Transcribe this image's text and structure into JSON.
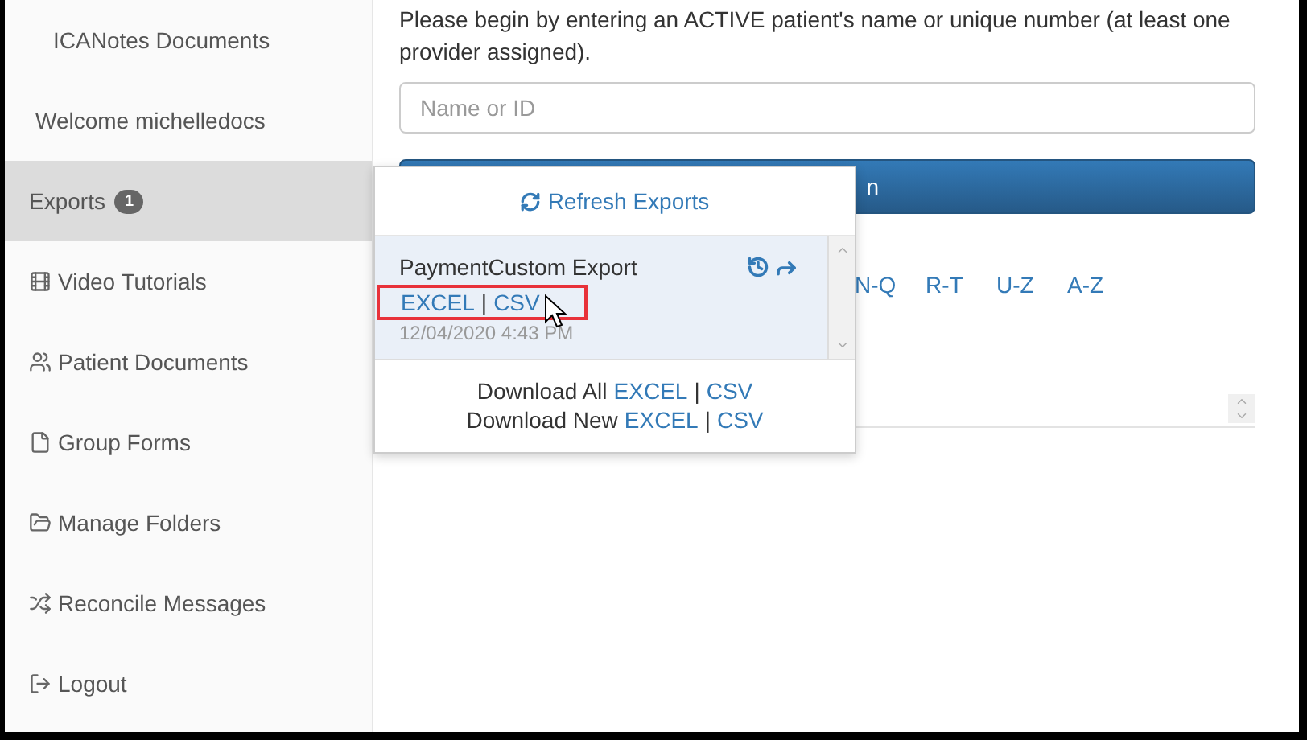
{
  "sidebar": {
    "items": [
      {
        "label": "ICANotes Documents",
        "kind": "title",
        "selected": false
      },
      {
        "label": "Welcome michelledocs",
        "kind": "title",
        "selected": false
      },
      {
        "label": "Exports",
        "kind": "link",
        "selected": true,
        "badge": "1"
      },
      {
        "label": "Video Tutorials",
        "kind": "link",
        "selected": false
      },
      {
        "label": "Patient Documents",
        "kind": "link",
        "selected": false
      },
      {
        "label": "Group Forms",
        "kind": "link",
        "selected": false
      },
      {
        "label": "Manage Folders",
        "kind": "link",
        "selected": false
      },
      {
        "label": "Reconcile Messages",
        "kind": "link",
        "selected": false
      },
      {
        "label": "Logout",
        "kind": "link",
        "selected": false
      }
    ]
  },
  "main": {
    "instructions": "Please begin by entering an ACTIVE patient's name or unique number (at least one provider assigned).",
    "search": {
      "placeholder": "Name or ID"
    },
    "search_button": "n",
    "letter_links": [
      "N-Q",
      "R-T",
      "U-Z",
      "A-Z"
    ]
  },
  "exports_dropdown": {
    "refresh": "Refresh Exports",
    "exports": [
      {
        "name": "PaymentCustom Export",
        "excel": "EXCEL",
        "separator": "|",
        "csv": "CSV",
        "date": "12/04/2020 4:43 PM",
        "highlighted": true
      }
    ],
    "footer": [
      {
        "label": "Download All",
        "excel": "EXCEL",
        "separator": "|",
        "csv": "CSV"
      },
      {
        "label": "Download New",
        "excel": "EXCEL",
        "separator": "|",
        "csv": "CSV"
      }
    ]
  }
}
